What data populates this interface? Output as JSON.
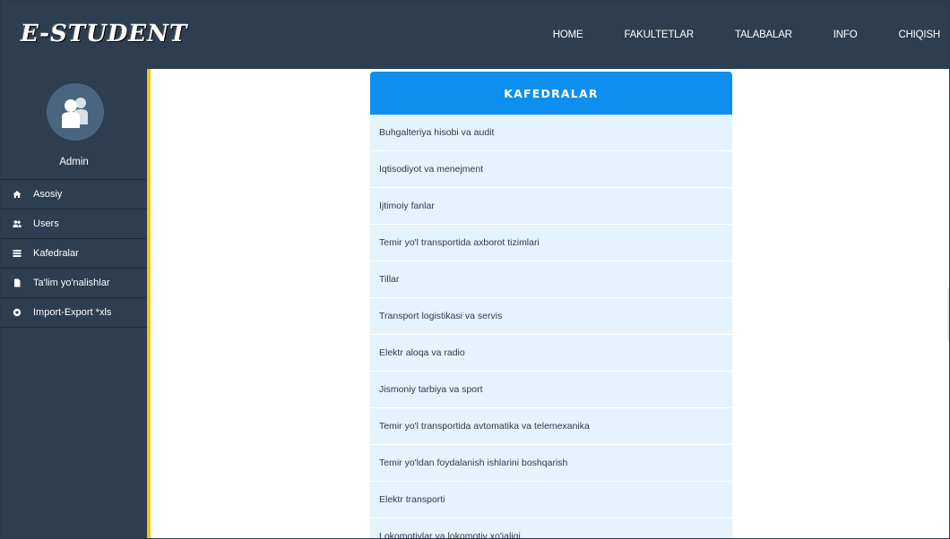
{
  "brand": {
    "logo_text": "E-STUDENT"
  },
  "nav": {
    "items": [
      {
        "label": "HOME"
      },
      {
        "label": "FAKULTETLAR"
      },
      {
        "label": "TALABALAR"
      },
      {
        "label": "INFO"
      },
      {
        "label": "CHIQISH"
      }
    ]
  },
  "sidebar": {
    "user_name": "Admin",
    "items": [
      {
        "label": "Asosiy",
        "icon": "home-icon"
      },
      {
        "label": "Users",
        "icon": "users-icon"
      },
      {
        "label": "Kafedralar",
        "icon": "table-icon"
      },
      {
        "label": "Ta'lim yo'nalishlar",
        "icon": "file-icon"
      },
      {
        "label": "Import-Export *xls",
        "icon": "circle-icon"
      }
    ]
  },
  "main": {
    "title": "KAFEDRALAR",
    "departments": [
      "Buhgalteriya hisobi va audit",
      "Iqtisodiyot va menejment",
      "Ijtimoiy fanlar",
      "Temir yo'l transportida axborot tizimlari",
      "Tillar",
      "Transport logistikasi va servis",
      "Elektr aloqa va radio",
      "Jismoniy tarbiya va sport",
      "Temir yo'l transportida avtomatika va telemexanika",
      "Temir yo'ldan foydalanish ishlarini boshqarish",
      "Elektr transporti",
      "Lokomotivlar va lokomotiv xo'jaligi"
    ]
  },
  "colors": {
    "navbar": "#2c3e50",
    "accent_yellow": "#f1c40f",
    "header_blue": "#0d8ff0",
    "row_bg": "#e4f3fd"
  }
}
